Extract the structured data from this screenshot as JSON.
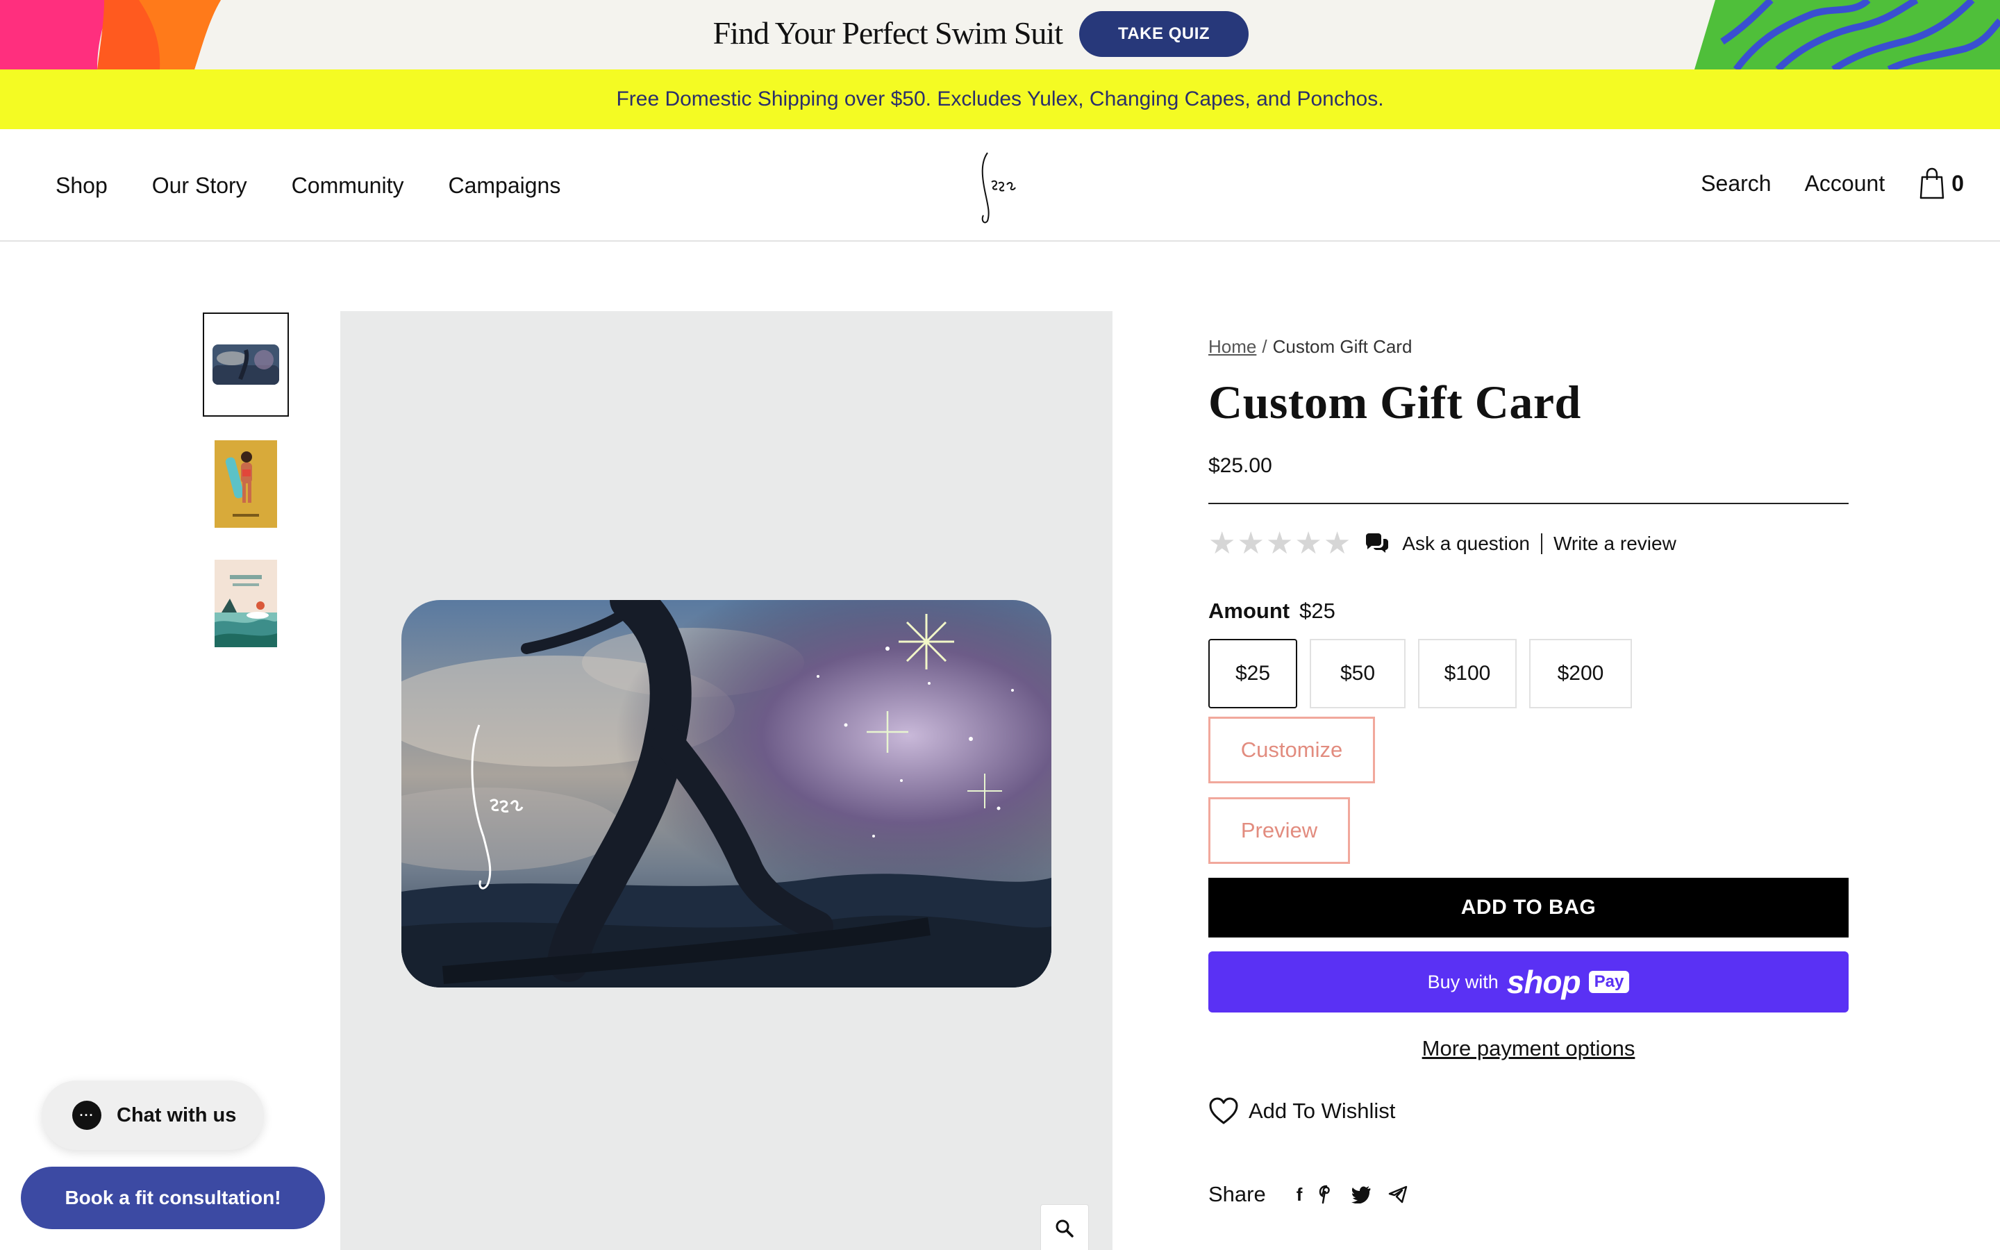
{
  "quiz_banner": {
    "title": "Find Your Perfect Swim Suit",
    "button_label": "TAKE QUIZ"
  },
  "shipping_bar": {
    "text": "Free Domestic Shipping over $50. Excludes Yulex, Changing Capes, and Ponchos."
  },
  "header": {
    "nav_left": [
      "Shop",
      "Our Story",
      "Community",
      "Campaigns"
    ],
    "nav_right": {
      "search": "Search",
      "account": "Account",
      "bag_count": "0"
    },
    "logo_icon": "seea-script-logo"
  },
  "gallery": {
    "thumbnails": [
      "surfer-gift-card",
      "yellow-illustration-card",
      "beach-illustration-card"
    ],
    "selected_index": 0,
    "zoom_icon": "magnifier-icon"
  },
  "product": {
    "breadcrumb": {
      "home": "Home",
      "separator": "/",
      "current": "Custom Gift Card"
    },
    "title": "Custom Gift Card",
    "price": "$25.00",
    "rating_stars": 0,
    "ask_question": "Ask a question",
    "write_review": "Write a review",
    "amount_label": "Amount",
    "amount_value": "$25",
    "amount_options": [
      "$25",
      "$50",
      "$100",
      "$200"
    ],
    "selected_amount": "$25",
    "customize_label": "Customize",
    "preview_label": "Preview",
    "add_to_bag_label": "ADD TO BAG",
    "shop_pay": {
      "buy_with": "Buy with",
      "shop": "shop",
      "pay": "Pay"
    },
    "more_payment_label": "More payment options",
    "wishlist_label": "Add To Wishlist",
    "share_label": "Share",
    "share_icons": [
      "facebook-icon",
      "pinterest-icon",
      "twitter-icon",
      "telegram-icon"
    ]
  },
  "widgets": {
    "chat_label": "Chat with us",
    "fit_button_label": "Book a fit consultation!"
  },
  "colors": {
    "shipping_bar_bg": "#f4fb23",
    "quiz_button_bg": "#27387a",
    "shop_pay_bg": "#5a31f4",
    "outline_btn_border": "#f1a89c",
    "fit_button_bg": "#3c4aa3"
  }
}
